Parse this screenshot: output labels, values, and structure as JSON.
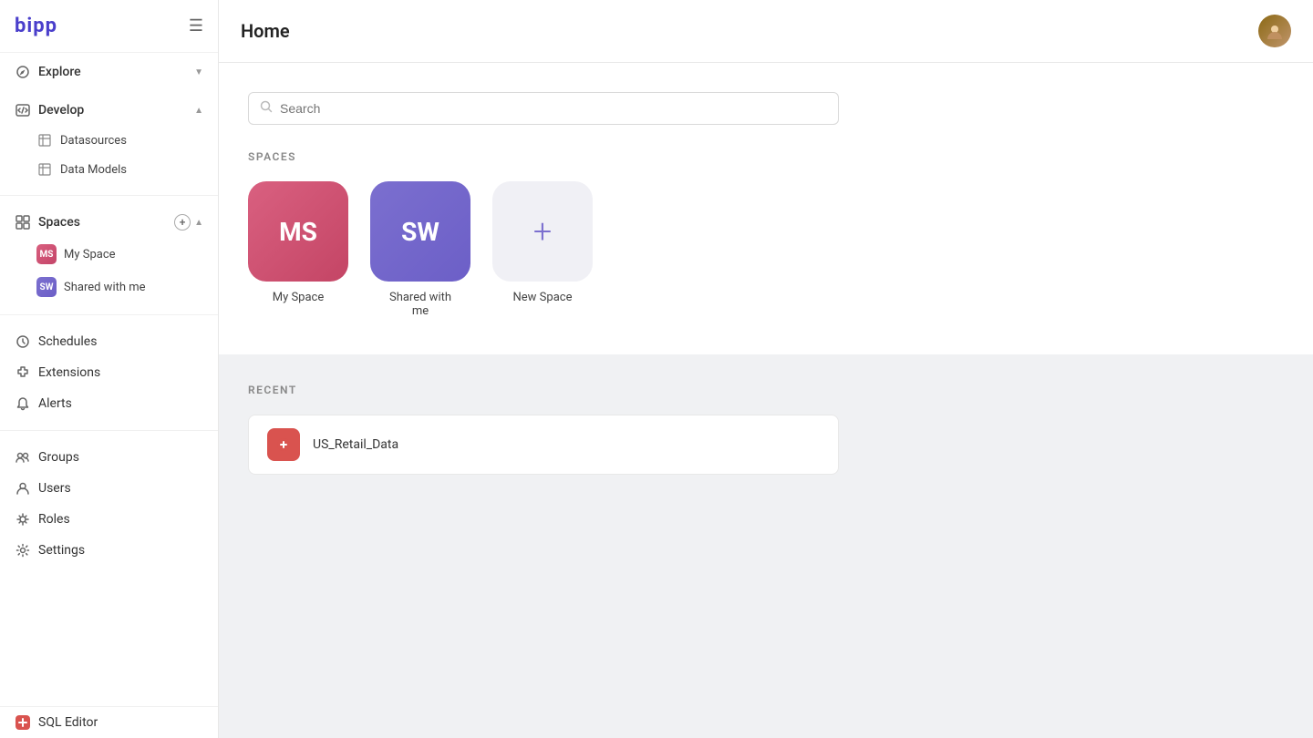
{
  "app": {
    "logo": "bipp",
    "page_title": "Home"
  },
  "sidebar": {
    "hamburger": "☰",
    "explore": {
      "label": "Explore",
      "icon": "🔍"
    },
    "develop": {
      "label": "Develop",
      "icon": "💻",
      "items": [
        {
          "label": "Datasources",
          "icon": "⊞"
        },
        {
          "label": "Data Models",
          "icon": "⊞"
        }
      ]
    },
    "spaces": {
      "label": "Spaces",
      "icon": "⬡",
      "items": [
        {
          "label": "My Space",
          "initials": "MS",
          "type": "ms"
        },
        {
          "label": "Shared with me",
          "initials": "SW",
          "type": "sw"
        }
      ]
    },
    "bottom_items": [
      {
        "label": "Schedules",
        "icon": "⏰"
      },
      {
        "label": "Extensions",
        "icon": "🧩"
      },
      {
        "label": "Alerts",
        "icon": "🔔"
      },
      {
        "label": "Groups",
        "icon": "👥"
      },
      {
        "label": "Users",
        "icon": "👤"
      },
      {
        "label": "Roles",
        "icon": "🔑"
      },
      {
        "label": "Settings",
        "icon": "⚙"
      }
    ],
    "sql_editor": {
      "label": "SQL Editor",
      "icon": "📊"
    }
  },
  "search": {
    "placeholder": "Search"
  },
  "spaces_section": {
    "title": "SPACES",
    "cards": [
      {
        "label": "My Space",
        "initials": "MS",
        "type": "ms"
      },
      {
        "label": "Shared with me",
        "initials": "SW",
        "type": "sw"
      },
      {
        "label": "New Space",
        "symbol": "+",
        "type": "new"
      }
    ]
  },
  "recent_section": {
    "title": "RECENT",
    "items": [
      {
        "label": "US_Retail_Data"
      }
    ]
  }
}
